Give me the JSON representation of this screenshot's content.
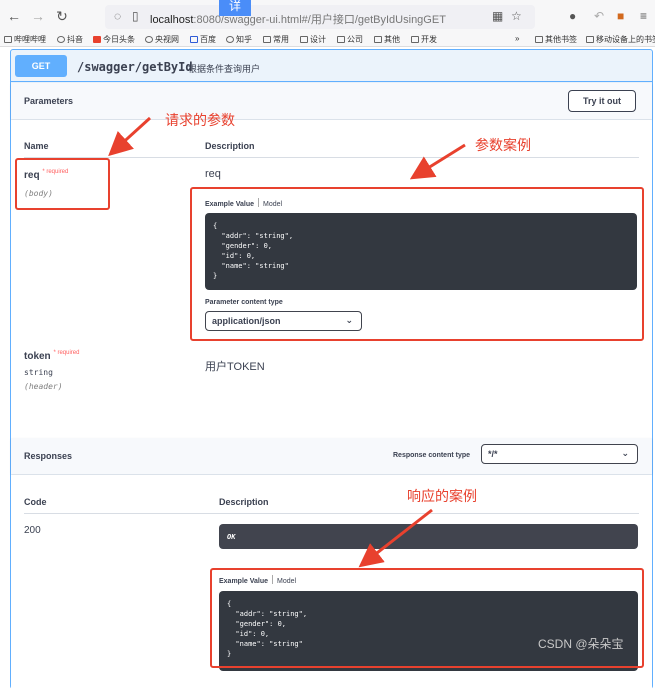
{
  "browser": {
    "url_host": "localhost",
    "url_rest": ":8080/swagger-ui.html#/用户接口/getByIdUsingGET",
    "overlay_char": "详",
    "bookmarks": [
      "哔哩哔哩",
      "抖音",
      "今日头条",
      "央视网",
      "百度",
      "知乎",
      "常用",
      "设计",
      "公司",
      "其他",
      "开发"
    ],
    "bookmarks_right": [
      "其他书签",
      "移动设备上的书签"
    ]
  },
  "operation": {
    "method": "GET",
    "path": "/swagger/getById",
    "summary": "根据条件查询用户"
  },
  "parameters": {
    "title": "Parameters",
    "try_label": "Try it out",
    "col_name": "Name",
    "col_description": "Description",
    "req": {
      "name": "req",
      "required": "* required",
      "in": "(body)",
      "description": "req",
      "tab_example": "Example Value",
      "tab_model": "Model",
      "example": "{\n  \"addr\": \"string\",\n  \"gender\": 0,\n  \"id\": 0,\n  \"name\": \"string\"\n}",
      "content_type_label": "Parameter content type",
      "content_type": "application/json"
    },
    "token": {
      "name": "token",
      "required": "* required",
      "type": "string",
      "in": "(header)",
      "description": "用户TOKEN"
    }
  },
  "responses": {
    "title": "Responses",
    "content_type_label": "Response content type",
    "content_type": "*/*",
    "col_code": "Code",
    "col_description": "Description",
    "code": "200",
    "ok": "OK",
    "tab_example": "Example Value",
    "tab_model": "Model",
    "example": "{\n  \"addr\": \"string\",\n  \"gender\": 0,\n  \"id\": 0,\n  \"name\": \"string\"\n}"
  },
  "annotations": {
    "request_params": "请求的参数",
    "param_example": "参数案例",
    "response_example": "响应的案例"
  },
  "watermark": "CSDN @朵朵宝"
}
